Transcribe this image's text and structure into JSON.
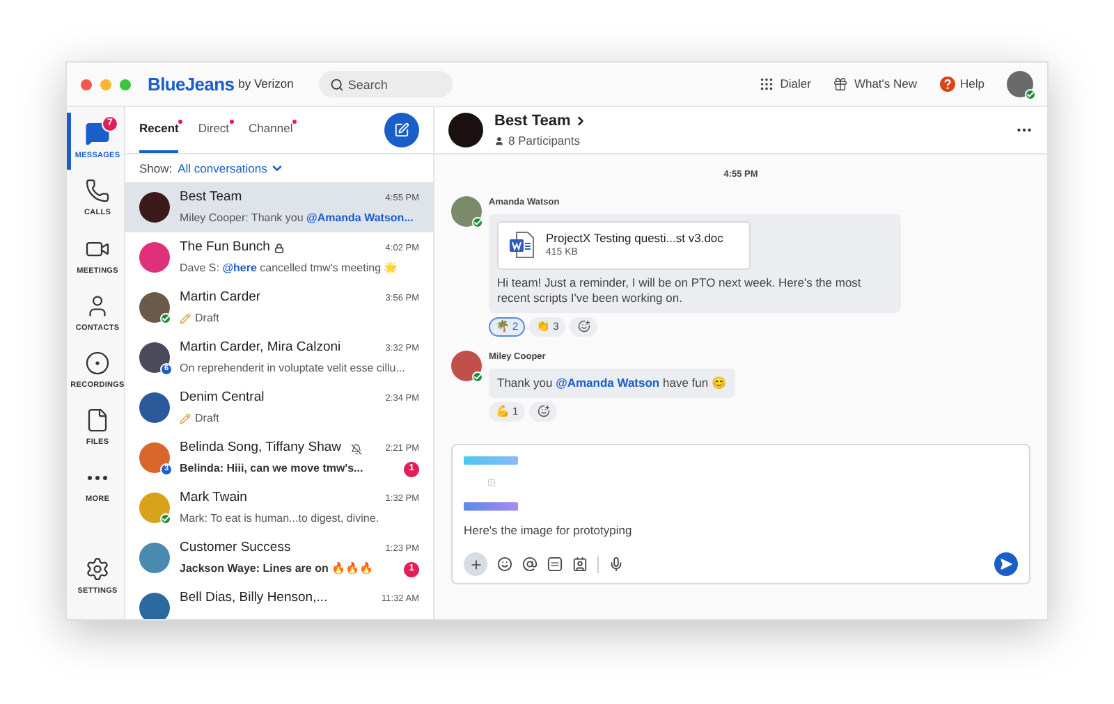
{
  "topbar": {
    "logo": "BlueJeans",
    "logo_suffix": "by Verizon",
    "search": {
      "placeholder": "Search"
    },
    "actions": [
      {
        "kind": "dialer",
        "label": "Dialer"
      },
      {
        "kind": "gift",
        "label": "What's New"
      },
      {
        "kind": "help",
        "label": "Help"
      }
    ],
    "user_online": true
  },
  "nav": [
    {
      "kind": "messages",
      "label": "MESSAGES",
      "selected": true,
      "badge": "7"
    },
    {
      "kind": "calls",
      "label": "CALLS",
      "selected": false
    },
    {
      "kind": "meetings",
      "label": "MEETINGS",
      "selected": false
    },
    {
      "kind": "contacts",
      "label": "CONTACTS",
      "selected": false
    },
    {
      "kind": "recordings",
      "label": "RECORDINGS",
      "selected": false
    },
    {
      "kind": "files",
      "label": "FILES",
      "selected": false
    },
    {
      "kind": "more",
      "label": "MORE",
      "selected": false
    },
    {
      "kind": "settings",
      "label": "SETTINGS",
      "selected": false
    }
  ],
  "list": {
    "tabs": [
      {
        "label": "Recent",
        "selected": true,
        "dot": true
      },
      {
        "label": "Direct",
        "selected": false,
        "dot": true
      },
      {
        "label": "Channel",
        "selected": false,
        "dot": true
      }
    ],
    "filter_label": "Show:",
    "filter_value": "All conversations",
    "conversations": [
      {
        "name": "Best Team",
        "time": "4:55 PM",
        "kind": "message",
        "preview": "Miley Cooper: Thank you **@Amanda Watson...**",
        "selected": true,
        "locked": false,
        "muted": false,
        "online": false,
        "color": "#3a1a1a"
      },
      {
        "name": "The Fun Bunch",
        "time": "4:02 PM",
        "kind": "message",
        "preview": "Dave S: **@here** cancelled tmw's meeting 🌟",
        "selected": false,
        "locked": true,
        "muted": false,
        "online": false,
        "color": "#e0307a"
      },
      {
        "name": "Martin Carder",
        "time": "3:56 PM",
        "kind": "draft",
        "preview": "Draft",
        "selected": false,
        "locked": false,
        "muted": false,
        "online": true,
        "color": "#6b5a4a"
      },
      {
        "name": "Martin Carder, Mira Calzoni",
        "time": "3:32 PM",
        "kind": "message",
        "preview": "On reprehenderit in voluptate velit esse cillu...",
        "member_count": "6",
        "selected": false,
        "locked": false,
        "muted": false,
        "online": false,
        "color": "#4a4a5a"
      },
      {
        "name": "Denim Central",
        "time": "2:34 PM",
        "kind": "draft",
        "preview": "Draft",
        "selected": false,
        "locked": false,
        "muted": false,
        "online": false,
        "color": "#2a5a9a"
      },
      {
        "name": "Belinda Song, Tiffany Shaw",
        "time": "2:21 PM",
        "kind": "message",
        "preview": "Belinda: Hiii, can we move tmw's...",
        "member_count": "3",
        "unread": "1",
        "selected": false,
        "locked": false,
        "muted": true,
        "online": false,
        "color": "#d9662a"
      },
      {
        "name": "Mark Twain",
        "time": "1:32 PM",
        "kind": "message",
        "preview": "Mark: To eat is human...to digest, divine.",
        "selected": false,
        "locked": false,
        "muted": false,
        "online": true,
        "color": "#d8a21a"
      },
      {
        "name": "Customer Success",
        "time": "1:23 PM",
        "kind": "message",
        "preview": "Jackson Waye: Lines are on 🔥🔥🔥",
        "unread": "1",
        "selected": false,
        "locked": false,
        "muted": false,
        "online": false,
        "color": "#4a8ab0"
      },
      {
        "name": "Bell Dias, Billy Henson,...",
        "time": "11:32 AM",
        "kind": "message",
        "selected": false,
        "locked": false,
        "muted": false,
        "online": false,
        "color": "#2a6aa0"
      }
    ]
  },
  "chat": {
    "title": "Best Team",
    "participants": "8 Participants",
    "divider_time": "4:55 PM",
    "messages": [
      {
        "author": "Amanda Watson",
        "online": true,
        "color": "#7a8a6a",
        "attachment": {
          "name": "ProjectX Testing questi...st v3.doc",
          "size": "415 KB"
        },
        "text": "Hi team! Just a reminder, I will be on PTO next week. Here's the most recent scripts I've been working on.",
        "reactions": [
          {
            "emoji": "🌴",
            "count": "2",
            "selected": true
          },
          {
            "emoji": "👏",
            "count": "3",
            "selected": false
          }
        ]
      },
      {
        "author": "Miley Cooper",
        "online": true,
        "color": "#c0504a",
        "text": "Thank you **@Amanda Watson** have fun 😊",
        "reactions": [
          {
            "emoji": "💪",
            "count": "1",
            "selected": false
          }
        ]
      }
    ]
  },
  "composer": {
    "value": "Here's the image for prototyping"
  }
}
